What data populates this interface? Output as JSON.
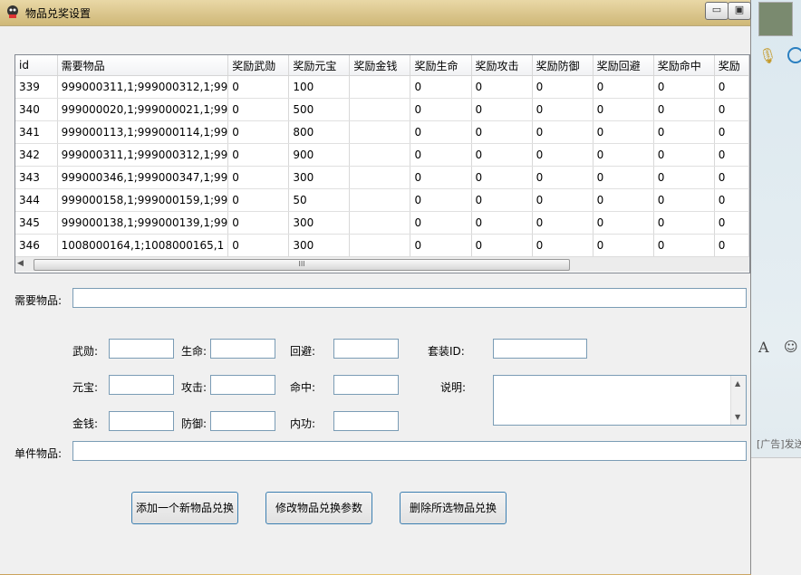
{
  "window": {
    "title": "物品兑奖设置",
    "minimize_glyph": "▭",
    "maximize_glyph": "▣"
  },
  "table": {
    "columns": [
      "id",
      "需要物品",
      "奖励武勋",
      "奖励元宝",
      "奖励金钱",
      "奖励生命",
      "奖励攻击",
      "奖励防御",
      "奖励回避",
      "奖励命中",
      "奖励"
    ],
    "rows": [
      [
        "339",
        "999000311,1;999000312,1;99",
        "0",
        "100",
        "",
        "0",
        "0",
        "0",
        "0",
        "0",
        "0"
      ],
      [
        "340",
        "999000020,1;999000021,1;99",
        "0",
        "500",
        "",
        "0",
        "0",
        "0",
        "0",
        "0",
        "0"
      ],
      [
        "341",
        "999000113,1;999000114,1;99",
        "0",
        "800",
        "",
        "0",
        "0",
        "0",
        "0",
        "0",
        "0"
      ],
      [
        "342",
        "999000311,1;999000312,1;99",
        "0",
        "900",
        "",
        "0",
        "0",
        "0",
        "0",
        "0",
        "0"
      ],
      [
        "343",
        "999000346,1;999000347,1;99",
        "0",
        "300",
        "",
        "0",
        "0",
        "0",
        "0",
        "0",
        "0"
      ],
      [
        "344",
        "999000158,1;999000159,1;99",
        "0",
        "50",
        "",
        "0",
        "0",
        "0",
        "0",
        "0",
        "0"
      ],
      [
        "345",
        "999000138,1;999000139,1;99",
        "0",
        "300",
        "",
        "0",
        "0",
        "0",
        "0",
        "0",
        "0"
      ],
      [
        "346",
        "1008000164,1;1008000165,1",
        "0",
        "300",
        "",
        "0",
        "0",
        "0",
        "0",
        "0",
        "0"
      ]
    ],
    "scroll_grip": "III"
  },
  "form": {
    "need_items_label": "需要物品:",
    "wuxun_label": "武勋:",
    "life_label": "生命:",
    "dodge_label": "回避:",
    "suit_id_label": "套装ID:",
    "yuanbao_label": "元宝:",
    "attack_label": "攻击:",
    "hit_label": "命中:",
    "desc_label": "说明:",
    "money_label": "金钱:",
    "defense_label": "防御:",
    "neigong_label": "内功:",
    "single_item_label": "单件物品:"
  },
  "buttons": {
    "add": "添加一个新物品兑换",
    "modify": "修改物品兑换参数",
    "delete": "删除所选物品兑换"
  },
  "side_panel": {
    "ad_text": "[广告]发送",
    "font_glyph": "A",
    "smile_glyph": "☺",
    "mic_glyph": "🎙"
  },
  "colors": {
    "title_bar": "#d9c48a",
    "field_border": "#7a9cb5",
    "button_border": "#3c7fb1"
  }
}
